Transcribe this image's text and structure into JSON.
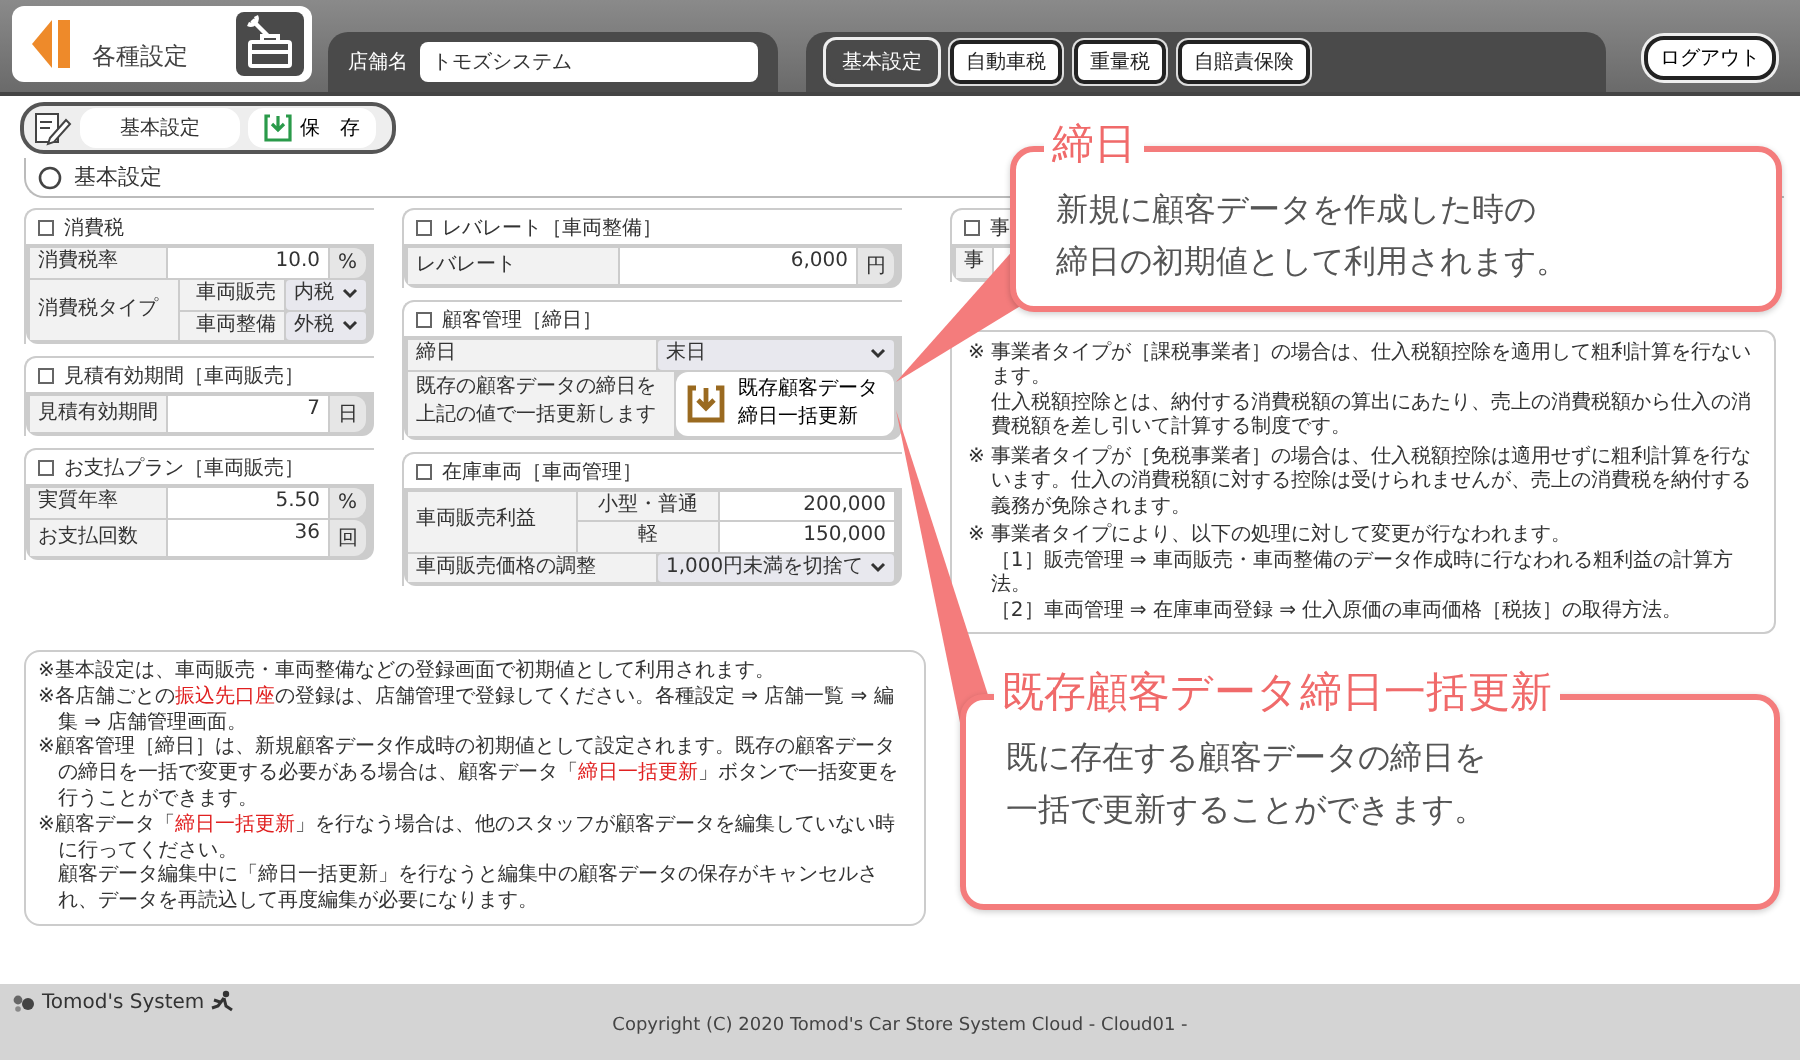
{
  "header": {
    "back_title": "各種設定",
    "store_label": "店舗名",
    "store_name": "トモズシステム",
    "tabs": [
      {
        "label": "基本設定",
        "selected": true
      },
      {
        "label": "自動車税",
        "selected": false
      },
      {
        "label": "重量税",
        "selected": false
      },
      {
        "label": "自賠責保険",
        "selected": false
      }
    ],
    "logout": "ログアウト"
  },
  "toolbar": {
    "title": "基本設定",
    "save": "保　存"
  },
  "section_title": "基本設定",
  "columns": [
    {
      "panels": [
        {
          "title": "消費税",
          "rows": [
            {
              "kind": "input",
              "label": "消費税率",
              "value": "10.0",
              "unit": "%"
            },
            {
              "kind": "group",
              "label": "消費税タイプ",
              "sub": [
                {
                  "kind": "select",
                  "label": "車両販売",
                  "value": "内税"
                },
                {
                  "kind": "select",
                  "label": "車両整備",
                  "value": "外税"
                }
              ]
            }
          ]
        },
        {
          "title": "見積有効期間［車両販売］",
          "rows": [
            {
              "kind": "input",
              "label": "見積有効期間",
              "value": "7",
              "unit": "日"
            }
          ]
        },
        {
          "title": "お支払プラン［車両販売］",
          "rows": [
            {
              "kind": "input",
              "label": "実質年率",
              "value": "5.50",
              "unit": "%"
            },
            {
              "kind": "input",
              "label": "お支払回数",
              "value": "36",
              "unit": "回"
            }
          ]
        }
      ]
    },
    {
      "panels": [
        {
          "title": "レバレート［車両整備］",
          "rows": [
            {
              "kind": "input",
              "label": "レバレート",
              "value": "6,000",
              "unit": "円"
            }
          ]
        },
        {
          "title": "顧客管理［締日］",
          "rows": [
            {
              "kind": "select",
              "label": "締日",
              "value": "末日"
            },
            {
              "kind": "button",
              "label_lines": [
                "既存の顧客データの締日を",
                "上記の値で一括更新します"
              ],
              "button_lines": [
                "既存顧客データ",
                "締日一括更新"
              ]
            }
          ]
        },
        {
          "title": "在庫車両［車両管理］",
          "rows": [
            {
              "kind": "group",
              "label": "車両販売利益",
              "sub": [
                {
                  "kind": "input",
                  "label": "小型・普通",
                  "value": "200,000"
                },
                {
                  "kind": "input",
                  "label": "軽",
                  "value": "150,000"
                }
              ]
            },
            {
              "kind": "select",
              "label": "車両販売価格の調整",
              "value": "1,000円未満を切捨て"
            }
          ]
        }
      ]
    },
    {
      "panels": [
        {
          "title": "事",
          "rows": [
            {
              "kind": "label",
              "label": "事"
            }
          ]
        }
      ]
    }
  ],
  "type_notes": [
    {
      "mark": "※",
      "lines": [
        "事業者タイプが［課税事業者］の場合は、仕入税額控除を適用して粗利計算を行ないます。",
        "仕入税額控除とは、納付する消費税額の算出にあたり、売上の消費税額から仕入の消費税額を差し引いて計算する制度です。"
      ]
    },
    {
      "mark": "※",
      "lines": [
        "事業者タイプが［免税事業者］の場合は、仕入税額控除は適用せずに粗利計算を行ないます。仕入の消費税額に対する控除は受けられませんが、売上の消費税を納付する義務が免除されます。"
      ]
    },
    {
      "mark": "※",
      "lines": [
        "事業者タイプにより、以下の処理に対して変更が行なわれます。",
        "［1］販売管理 ⇒ 車両販売・車両整備のデータ作成時に行なわれる粗利益の計算方法。",
        "［2］車両管理 ⇒ 在庫車両登録 ⇒ 仕入原価の車両価格［税抜］の取得方法。"
      ]
    }
  ],
  "notes": [
    {
      "lines": [
        [
          {
            "text": "※基本設定は、車両販売・車両整備などの登録画面で初期値として利用されます。",
            "highlight": false
          }
        ]
      ]
    },
    {
      "lines": [
        [
          {
            "text": "※各店舗ごとの",
            "highlight": false
          },
          {
            "text": "振込先口座",
            "highlight": true
          },
          {
            "text": "の登録は、店舗管理で登録してください。各種設定 ⇒ 店舗一覧 ⇒ 編集 ⇒ 店舗管理画面。",
            "highlight": false
          }
        ]
      ]
    },
    {
      "lines": [
        [
          {
            "text": "※顧客管理［締日］は、新規顧客データ作成時の初期値として設定されます。既存の顧客データの締日を一括で変更する必要がある場合は、顧客データ「",
            "highlight": false
          },
          {
            "text": "締日一括更新",
            "highlight": true
          },
          {
            "text": "」ボタンで一括変更を行うことができます。",
            "highlight": false
          }
        ]
      ]
    },
    {
      "lines": [
        [
          {
            "text": "※顧客データ「",
            "highlight": false
          },
          {
            "text": "締日一括更新",
            "highlight": true
          },
          {
            "text": "」を行なう場合は、他のスタッフが顧客データを編集していない時に行ってください。",
            "highlight": false
          }
        ],
        [
          {
            "text": "顧客データ編集中に「締日一括更新」を行なうと編集中の顧客データの保存がキャンセルされ、データを再読込して再度編集が必要になります。",
            "highlight": false
          }
        ]
      ]
    }
  ],
  "callouts": [
    {
      "title": "締日",
      "lines": [
        "新規に顧客データを作成した時の",
        "締日の初期値として利用されます。"
      ]
    },
    {
      "title": "既存顧客データ締日一括更新",
      "lines": [
        "既に存在する顧客データの締日を",
        "一括で更新することができます。"
      ]
    }
  ],
  "footer": {
    "brand": "Tomod's System",
    "copyright": "Copyright (C) 2020 Tomod's Car Store System Cloud - Cloud01 -"
  }
}
